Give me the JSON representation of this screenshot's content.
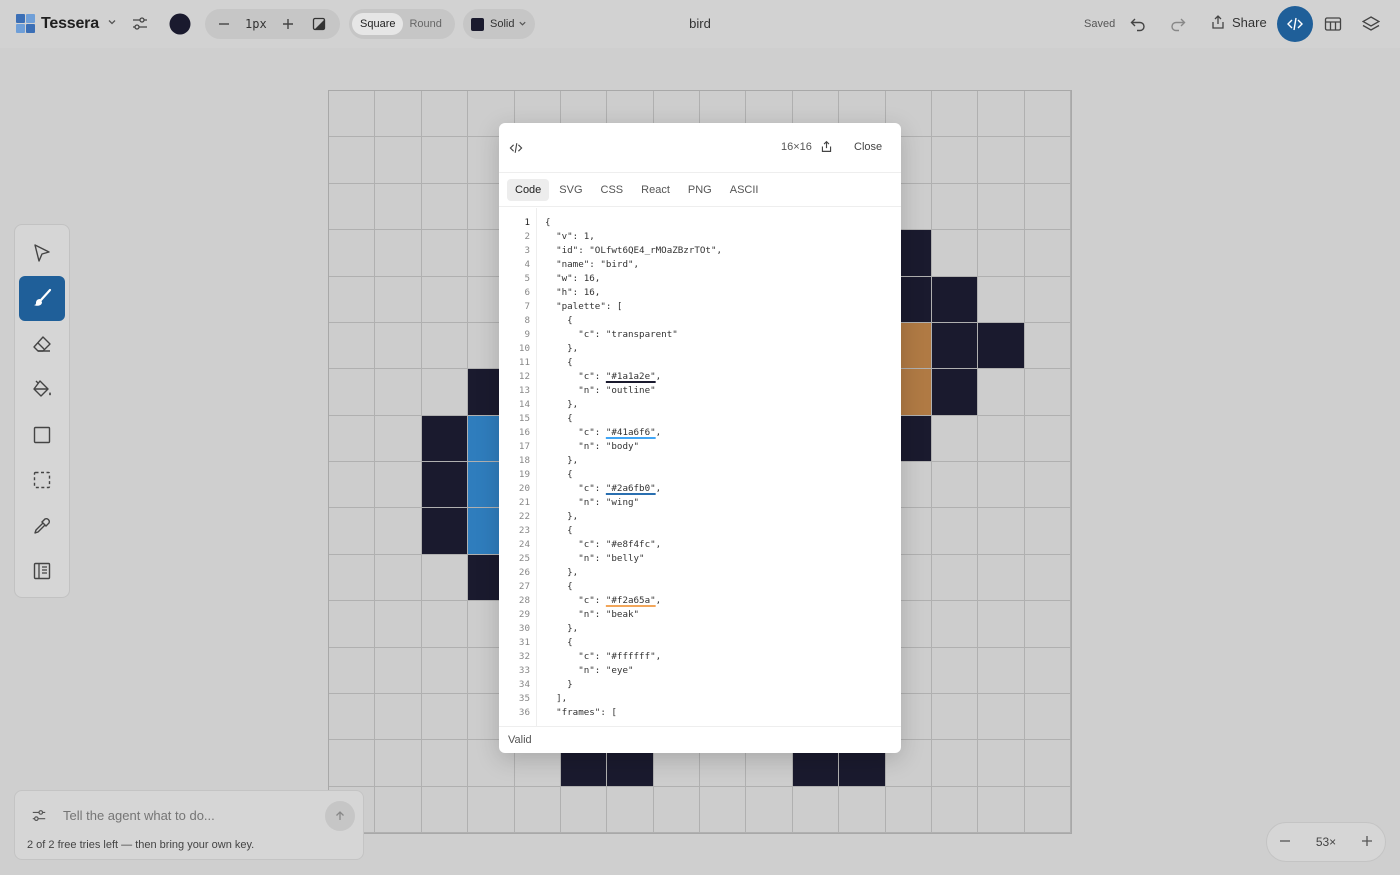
{
  "app": {
    "name": "Tessera",
    "document_title": "bird",
    "save_status": "Saved",
    "share_label": "Share"
  },
  "toolbar": {
    "brush_size": "1px",
    "cap_square": "Square",
    "cap_round": "Round",
    "fill_mode": "Solid",
    "active_color": "#1a1a2e"
  },
  "modal": {
    "size_label": "16×16",
    "close_label": "Close",
    "tabs": [
      "Code",
      "SVG",
      "CSS",
      "React",
      "PNG",
      "ASCII"
    ],
    "active_tab": "Code",
    "status": "Valid",
    "code_lines": [
      "{",
      "  \"v\": 1,",
      "  \"id\": \"OLfwt6QE4_rMOaZBzrTOt\",",
      "  \"name\": \"bird\",",
      "  \"w\": 16,",
      "  \"h\": 16,",
      "  \"palette\": [",
      "    {",
      "      \"c\": \"transparent\"",
      "    },",
      "    {",
      "      \"c\": \"#1a1a2e\",",
      "      \"n\": \"outline\"",
      "    },",
      "    {",
      "      \"c\": \"#41a6f6\",",
      "      \"n\": \"body\"",
      "    },",
      "    {",
      "      \"c\": \"#2a6fb0\",",
      "      \"n\": \"wing\"",
      "    },",
      "    {",
      "      \"c\": \"#e8f4fc\",",
      "      \"n\": \"belly\"",
      "    },",
      "    {",
      "      \"c\": \"#f2a65a\",",
      "      \"n\": \"beak\"",
      "    },",
      "    {",
      "      \"c\": \"#ffffff\",",
      "      \"n\": \"eye\"",
      "    }",
      "  ],",
      "  \"frames\": ["
    ]
  },
  "agent": {
    "placeholder": "Tell the agent what to do...",
    "note": "2 of 2 free tries left — then bring your own key."
  },
  "zoom": {
    "level": "53×"
  },
  "colors": {
    "accent": "#1f5f99",
    "outline": "#1a1a2e",
    "body": "#2f7dbd",
    "beak": "#b07a44",
    "empty": "#cdcdcd"
  },
  "canvas_pixels": [
    "................",
    "................",
    "..........1.....",
    "..........211...",
    "..........2111..",
    "..........25511.",
    "...1......2551..",
    "..12......211...",
    "..12......1.....",
    "..12......1.....",
    "...1............",
    "................",
    "................",
    "................",
    ".....11...11....",
    "................"
  ]
}
